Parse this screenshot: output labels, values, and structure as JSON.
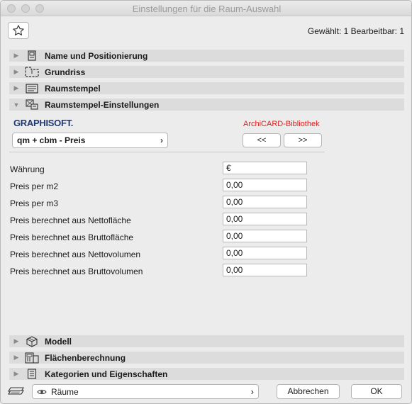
{
  "window": {
    "title": "Einstellungen für die Raum-Auswahl"
  },
  "toolbar": {
    "selection_info": "Gewählt: 1 Bearbeitbar: 1"
  },
  "sections": {
    "name": {
      "label": "Name und Positionierung",
      "expanded": false
    },
    "grundriss": {
      "label": "Grundriss",
      "expanded": false
    },
    "raumstempel": {
      "label": "Raumstempel",
      "expanded": false
    },
    "raumstempel_settings": {
      "label": "Raumstempel-Einstellungen",
      "expanded": true
    },
    "modell": {
      "label": "Modell",
      "expanded": false
    },
    "flaeche": {
      "label": "Flächenberechnung",
      "expanded": false
    },
    "kategorien": {
      "label": "Kategorien und Eigenschaften",
      "expanded": false
    }
  },
  "library": {
    "vendor_logo": "GRAPHISOFT.",
    "library_name": "ArchiCARD-Bibliothek",
    "selected_object": "qm + cbm - Preis",
    "prev_label": "<<",
    "next_label": ">>"
  },
  "params": [
    {
      "label": "Währung",
      "value": "€"
    },
    {
      "label": "Preis per m2",
      "value": "0,00"
    },
    {
      "label": "Preis per m3",
      "value": "0,00"
    },
    {
      "label": "Preis berechnet aus Nettofläche",
      "value": "0,00"
    },
    {
      "label": "Preis berechnet aus Bruttofläche",
      "value": "0,00"
    },
    {
      "label": "Preis berechnet aus Nettovolumen",
      "value": "0,00"
    },
    {
      "label": "Preis berechnet aus Bruttovolumen",
      "value": "0,00"
    }
  ],
  "footer": {
    "favorites_label": "Räume",
    "cancel_label": "Abbrechen",
    "ok_label": "OK"
  },
  "colors": {
    "library_name": "#e11d1d",
    "vendor_logo": "#1f3a73",
    "section_bg": "#dcdcdc",
    "window_bg": "#ececec"
  }
}
